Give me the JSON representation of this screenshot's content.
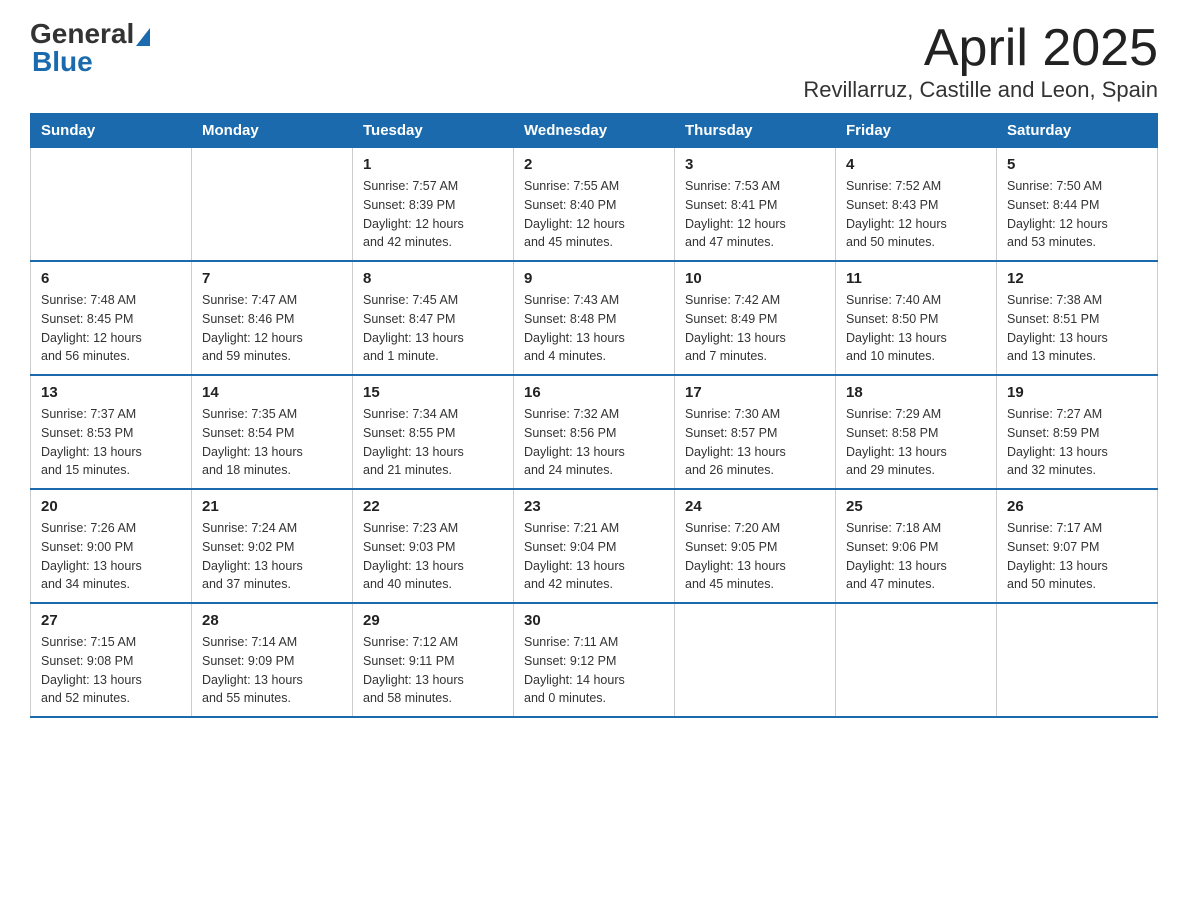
{
  "logo": {
    "general": "General",
    "blue": "Blue"
  },
  "title": "April 2025",
  "location": "Revillarruz, Castille and Leon, Spain",
  "days_of_week": [
    "Sunday",
    "Monday",
    "Tuesday",
    "Wednesday",
    "Thursday",
    "Friday",
    "Saturday"
  ],
  "weeks": [
    [
      {
        "day": "",
        "info": ""
      },
      {
        "day": "",
        "info": ""
      },
      {
        "day": "1",
        "info": "Sunrise: 7:57 AM\nSunset: 8:39 PM\nDaylight: 12 hours\nand 42 minutes."
      },
      {
        "day": "2",
        "info": "Sunrise: 7:55 AM\nSunset: 8:40 PM\nDaylight: 12 hours\nand 45 minutes."
      },
      {
        "day": "3",
        "info": "Sunrise: 7:53 AM\nSunset: 8:41 PM\nDaylight: 12 hours\nand 47 minutes."
      },
      {
        "day": "4",
        "info": "Sunrise: 7:52 AM\nSunset: 8:43 PM\nDaylight: 12 hours\nand 50 minutes."
      },
      {
        "day": "5",
        "info": "Sunrise: 7:50 AM\nSunset: 8:44 PM\nDaylight: 12 hours\nand 53 minutes."
      }
    ],
    [
      {
        "day": "6",
        "info": "Sunrise: 7:48 AM\nSunset: 8:45 PM\nDaylight: 12 hours\nand 56 minutes."
      },
      {
        "day": "7",
        "info": "Sunrise: 7:47 AM\nSunset: 8:46 PM\nDaylight: 12 hours\nand 59 minutes."
      },
      {
        "day": "8",
        "info": "Sunrise: 7:45 AM\nSunset: 8:47 PM\nDaylight: 13 hours\nand 1 minute."
      },
      {
        "day": "9",
        "info": "Sunrise: 7:43 AM\nSunset: 8:48 PM\nDaylight: 13 hours\nand 4 minutes."
      },
      {
        "day": "10",
        "info": "Sunrise: 7:42 AM\nSunset: 8:49 PM\nDaylight: 13 hours\nand 7 minutes."
      },
      {
        "day": "11",
        "info": "Sunrise: 7:40 AM\nSunset: 8:50 PM\nDaylight: 13 hours\nand 10 minutes."
      },
      {
        "day": "12",
        "info": "Sunrise: 7:38 AM\nSunset: 8:51 PM\nDaylight: 13 hours\nand 13 minutes."
      }
    ],
    [
      {
        "day": "13",
        "info": "Sunrise: 7:37 AM\nSunset: 8:53 PM\nDaylight: 13 hours\nand 15 minutes."
      },
      {
        "day": "14",
        "info": "Sunrise: 7:35 AM\nSunset: 8:54 PM\nDaylight: 13 hours\nand 18 minutes."
      },
      {
        "day": "15",
        "info": "Sunrise: 7:34 AM\nSunset: 8:55 PM\nDaylight: 13 hours\nand 21 minutes."
      },
      {
        "day": "16",
        "info": "Sunrise: 7:32 AM\nSunset: 8:56 PM\nDaylight: 13 hours\nand 24 minutes."
      },
      {
        "day": "17",
        "info": "Sunrise: 7:30 AM\nSunset: 8:57 PM\nDaylight: 13 hours\nand 26 minutes."
      },
      {
        "day": "18",
        "info": "Sunrise: 7:29 AM\nSunset: 8:58 PM\nDaylight: 13 hours\nand 29 minutes."
      },
      {
        "day": "19",
        "info": "Sunrise: 7:27 AM\nSunset: 8:59 PM\nDaylight: 13 hours\nand 32 minutes."
      }
    ],
    [
      {
        "day": "20",
        "info": "Sunrise: 7:26 AM\nSunset: 9:00 PM\nDaylight: 13 hours\nand 34 minutes."
      },
      {
        "day": "21",
        "info": "Sunrise: 7:24 AM\nSunset: 9:02 PM\nDaylight: 13 hours\nand 37 minutes."
      },
      {
        "day": "22",
        "info": "Sunrise: 7:23 AM\nSunset: 9:03 PM\nDaylight: 13 hours\nand 40 minutes."
      },
      {
        "day": "23",
        "info": "Sunrise: 7:21 AM\nSunset: 9:04 PM\nDaylight: 13 hours\nand 42 minutes."
      },
      {
        "day": "24",
        "info": "Sunrise: 7:20 AM\nSunset: 9:05 PM\nDaylight: 13 hours\nand 45 minutes."
      },
      {
        "day": "25",
        "info": "Sunrise: 7:18 AM\nSunset: 9:06 PM\nDaylight: 13 hours\nand 47 minutes."
      },
      {
        "day": "26",
        "info": "Sunrise: 7:17 AM\nSunset: 9:07 PM\nDaylight: 13 hours\nand 50 minutes."
      }
    ],
    [
      {
        "day": "27",
        "info": "Sunrise: 7:15 AM\nSunset: 9:08 PM\nDaylight: 13 hours\nand 52 minutes."
      },
      {
        "day": "28",
        "info": "Sunrise: 7:14 AM\nSunset: 9:09 PM\nDaylight: 13 hours\nand 55 minutes."
      },
      {
        "day": "29",
        "info": "Sunrise: 7:12 AM\nSunset: 9:11 PM\nDaylight: 13 hours\nand 58 minutes."
      },
      {
        "day": "30",
        "info": "Sunrise: 7:11 AM\nSunset: 9:12 PM\nDaylight: 14 hours\nand 0 minutes."
      },
      {
        "day": "",
        "info": ""
      },
      {
        "day": "",
        "info": ""
      },
      {
        "day": "",
        "info": ""
      }
    ]
  ]
}
